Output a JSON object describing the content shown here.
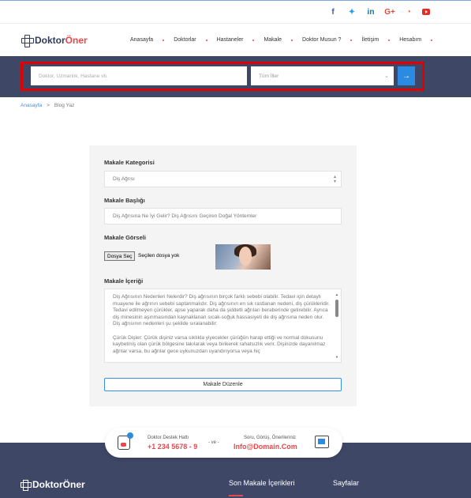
{
  "social": [
    "f",
    "t",
    "in",
    "G+",
    "rss",
    "yt"
  ],
  "logo": {
    "part1": "Doktor",
    "part2": "Öner"
  },
  "menu": [
    "Anasayfa",
    "Doktorlar",
    "Hastaneler",
    "Makale",
    "Doktor Musun ?",
    "İletişim",
    "Hesabım"
  ],
  "search": {
    "placeholder": "Doktor, Uzmanlık, Hastane vb.",
    "city": "Tüm İller",
    "go": "→"
  },
  "breadcrumb": {
    "home": "Anasayfa",
    "sep": ">",
    "current": "Blog Yaz"
  },
  "form": {
    "category_label": "Makale Kategorisi",
    "category_value": "Diş Ağrısı",
    "title_label": "Makale Başlığı",
    "title_value": "Diş Ağrısına Ne İyi Gelir? Diş Ağrısını Geçiren Doğal Yöntemler",
    "image_label": "Makale Görseli",
    "file_button": "Dosya Seç",
    "file_status": "Seçilen dosya yok",
    "content_label": "Makale İçeriği",
    "content_paragraphs": [
      "Diş Ağrısının Nedenleri Nelerdir? Diş ağrısının birçok farklı sebebi olabilir. Tedavi için detaylı muayene ile ağrının sebebi saptanmalıdır. Diş ağrısının en sık rastlanan nedeni, diş çürükleridir. Tedavi edilmeyen çürükler, apse yaparak daha da şiddetli ağrıları beraberinde getirebilir. Ayrıca diş minesinin aşınmasından kaynaklanan sıcak-soğuk hassasiyeti de diş ağrısına neden olur. Diş ağrısının nedenleri şu şekilde sıralanabilir:",
      "",
      "Çürük Dişler: Çürük dişiniz varsa sıklıkla yiyecekler çürüğün harap ettiği ve normal dokusunu kaybetmiş olan çürük bölgesine takılarak veya birikerek rahatsızlık verir. Dişinizde dayanılmaz ağrılar varsa, bu ağrılar gece uykunuzdan uyandırıyorsa veya hiç"
    ],
    "submit": "Makale Düzenle"
  },
  "support": {
    "line_label": "Doktor Destek Hattı",
    "phone": "+1 234 5678 - 9",
    "and": "- ve -",
    "mail_label": "Soru, Görüş, Önerileriniz",
    "email": "Info@Domain.Com"
  },
  "footer": {
    "recent": "Son Makale İçerikleri",
    "pages": "Sayfalar"
  },
  "colors": {
    "accent_red": "#e8474c",
    "blue": "#2b8be0",
    "navy": "#3e4766"
  }
}
